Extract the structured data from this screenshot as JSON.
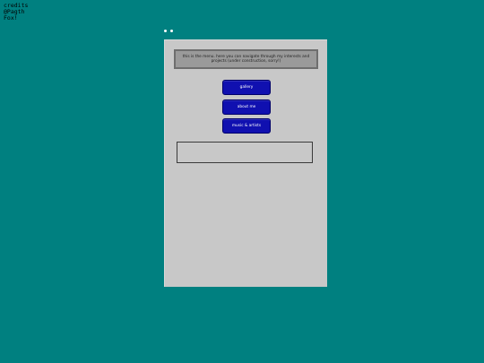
{
  "credits": {
    "lines": [
      "credits",
      "@Pagth",
      "Fox!"
    ]
  },
  "panel": {
    "info_text": "this is the menu. here you can navigate through my interests and projects (under construction, sorry!)",
    "buttons": [
      {
        "label": "gallery"
      },
      {
        "label": "about me"
      },
      {
        "label": "music & artists"
      }
    ]
  },
  "colors": {
    "background": "#008080",
    "panel": "#c8c8c8",
    "button": "#1010b0",
    "info_box": "#9a9a9a"
  }
}
